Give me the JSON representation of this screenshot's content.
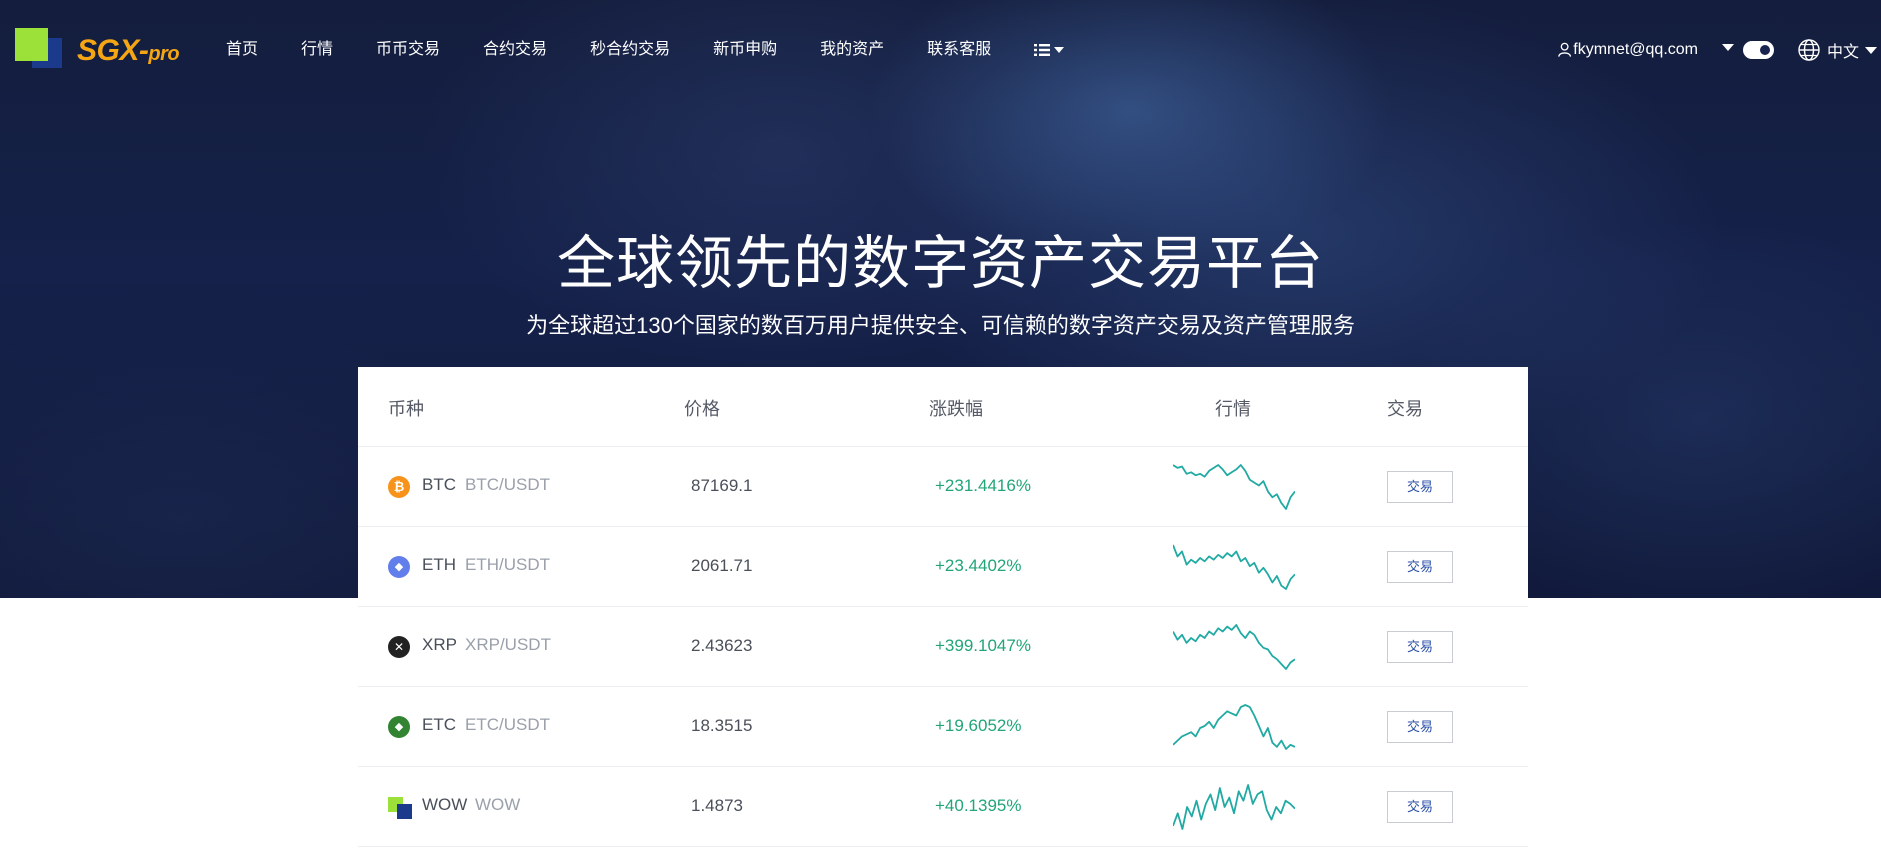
{
  "brand": {
    "name": "SGX-pro",
    "name_main": "SGX-",
    "name_small": "pro",
    "colors": {
      "text": "#f5a614",
      "square_light": "#9ce03a",
      "square_dark": "#1c3a8c"
    }
  },
  "nav": {
    "items": [
      "首页",
      "行情",
      "币币交易",
      "合约交易",
      "秒合约交易",
      "新币申购",
      "我的资产",
      "联系客服"
    ],
    "more_icon": "list-icon"
  },
  "header": {
    "user_email": "fkymnet@qq.com",
    "user_icon": "user-icon",
    "theme_toggle": "on",
    "language": "中文",
    "language_icon": "globe-icon"
  },
  "hero": {
    "title": "全球领先的数字资产交易平台",
    "subtitle": "为全球超过130个国家的数百万用户提供安全、可信赖的数字资产交易及资产管理服务"
  },
  "market": {
    "columns": [
      "币种",
      "价格",
      "涨跌幅",
      "行情",
      "交易"
    ],
    "rows": [
      {
        "symbol": "BTC",
        "pair": "BTC/USDT",
        "price": "87169.1",
        "change": "+231.4416%",
        "trade_label": "交易",
        "icon": "bitcoin-icon",
        "icon_color": "#f7931a",
        "icon_glyph": "₿",
        "trend": [
          40,
          38,
          39,
          34,
          35,
          33,
          34,
          32,
          36,
          38,
          40,
          37,
          33,
          35,
          37,
          40,
          36,
          30,
          28,
          26,
          29,
          22,
          18,
          20,
          14,
          10,
          18,
          22
        ]
      },
      {
        "symbol": "ETH",
        "pair": "ETH/USDT",
        "price": "2061.71",
        "change": "+23.4402%",
        "trade_label": "交易",
        "icon": "ethereum-icon",
        "icon_color": "#627eea",
        "icon_glyph": "◆",
        "trend": [
          42,
          35,
          38,
          30,
          33,
          31,
          34,
          32,
          35,
          33,
          36,
          34,
          37,
          35,
          38,
          32,
          34,
          29,
          31,
          25,
          28,
          24,
          19,
          23,
          17,
          15,
          21,
          24
        ]
      },
      {
        "symbol": "XRP",
        "pair": "XRP/USDT",
        "price": "2.43623",
        "change": "+399.1047%",
        "trade_label": "交易",
        "icon": "xrp-icon",
        "icon_color": "#222222",
        "icon_glyph": "✕",
        "trend": [
          35,
          30,
          33,
          28,
          31,
          29,
          33,
          31,
          35,
          33,
          37,
          35,
          38,
          36,
          39,
          34,
          31,
          35,
          33,
          28,
          25,
          24,
          20,
          18,
          15,
          12,
          16,
          18
        ]
      },
      {
        "symbol": "ETC",
        "pair": "ETC/USDT",
        "price": "18.3515",
        "change": "+19.6052%",
        "trade_label": "交易",
        "icon": "ethereum-classic-icon",
        "icon_color": "#328332",
        "icon_glyph": "◆",
        "trend": [
          16,
          18,
          20,
          21,
          22,
          20,
          24,
          25,
          27,
          24,
          28,
          30,
          32,
          31,
          30,
          34,
          35,
          34,
          30,
          25,
          20,
          24,
          17,
          15,
          18,
          14,
          16,
          15
        ]
      },
      {
        "symbol": "WOW",
        "pair": "WOW",
        "price": "1.4873",
        "change": "+40.1395%",
        "trade_label": "交易",
        "icon": "wow-logo-icon",
        "icon_color": "#9ce03a",
        "icon_glyph": "",
        "trend": [
          14,
          22,
          12,
          26,
          20,
          30,
          18,
          28,
          34,
          24,
          38,
          26,
          32,
          22,
          36,
          30,
          40,
          28,
          34,
          36,
          24,
          18,
          26,
          22,
          30,
          28,
          25
        ]
      }
    ]
  },
  "colors": {
    "positive": "#21a579",
    "spark": "#21aaa3",
    "trade_text": "#2c4ea8"
  }
}
